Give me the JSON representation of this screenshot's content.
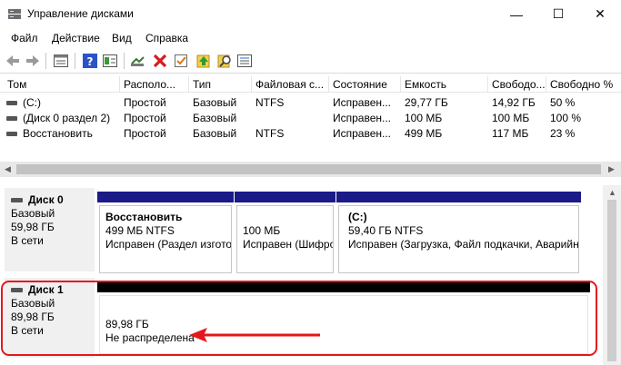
{
  "window": {
    "title": "Управление дисками",
    "controls": {
      "minimize": "—",
      "maximize": "☐",
      "close": "✕"
    }
  },
  "menu": [
    "Файл",
    "Действие",
    "Вид",
    "Справка"
  ],
  "toolbar": {
    "icons": [
      "back-icon",
      "forward-icon",
      "list-view-icon",
      "help-icon",
      "properties-icon",
      "connect-icon",
      "delete-icon",
      "check-icon",
      "upload-icon",
      "search-icon",
      "settings-icon"
    ]
  },
  "volumes": {
    "columns": [
      "Том",
      "Располо...",
      "Тип",
      "Файловая с...",
      "Состояние",
      "Емкость",
      "Свободо...",
      "Свободно %"
    ],
    "rows": [
      [
        "(C:)",
        "Простой",
        "Базовый",
        "NTFS",
        "Исправен...",
        "29,77 ГБ",
        "14,92 ГБ",
        "50 %"
      ],
      [
        "(Диск 0 раздел 2)",
        "Простой",
        "Базовый",
        "",
        "Исправен...",
        "100 МБ",
        "100 МБ",
        "100 %"
      ],
      [
        "Восстановить",
        "Простой",
        "Базовый",
        "NTFS",
        "Исправен...",
        "499 МБ",
        "117 МБ",
        "23 %"
      ]
    ]
  },
  "disks": [
    {
      "name": "Диск 0",
      "type": "Базовый",
      "size": "59,98 ГБ",
      "status": "В сети",
      "partitions": [
        {
          "title": "Восстановить",
          "line1": "499 МБ NTFS",
          "line2": "Исправен (Раздел изготов"
        },
        {
          "title": "",
          "line1": "100 МБ",
          "line2": "Исправен (Шифро"
        },
        {
          "title": "(C:)",
          "line1": "59,40 ГБ NTFS",
          "line2": "Исправен (Загрузка, Файл подкачки, Аварийн"
        }
      ]
    },
    {
      "name": "Диск 1",
      "type": "Базовый",
      "size": "89,98 ГБ",
      "status": "В сети",
      "partitions": [
        {
          "title": "",
          "line1": "89,98 ГБ",
          "line2": "Не распределена"
        }
      ]
    }
  ],
  "colors": {
    "primary_bar": "#1a1a88",
    "unallocated_bar": "#000000",
    "annotation": "#e5161c"
  }
}
